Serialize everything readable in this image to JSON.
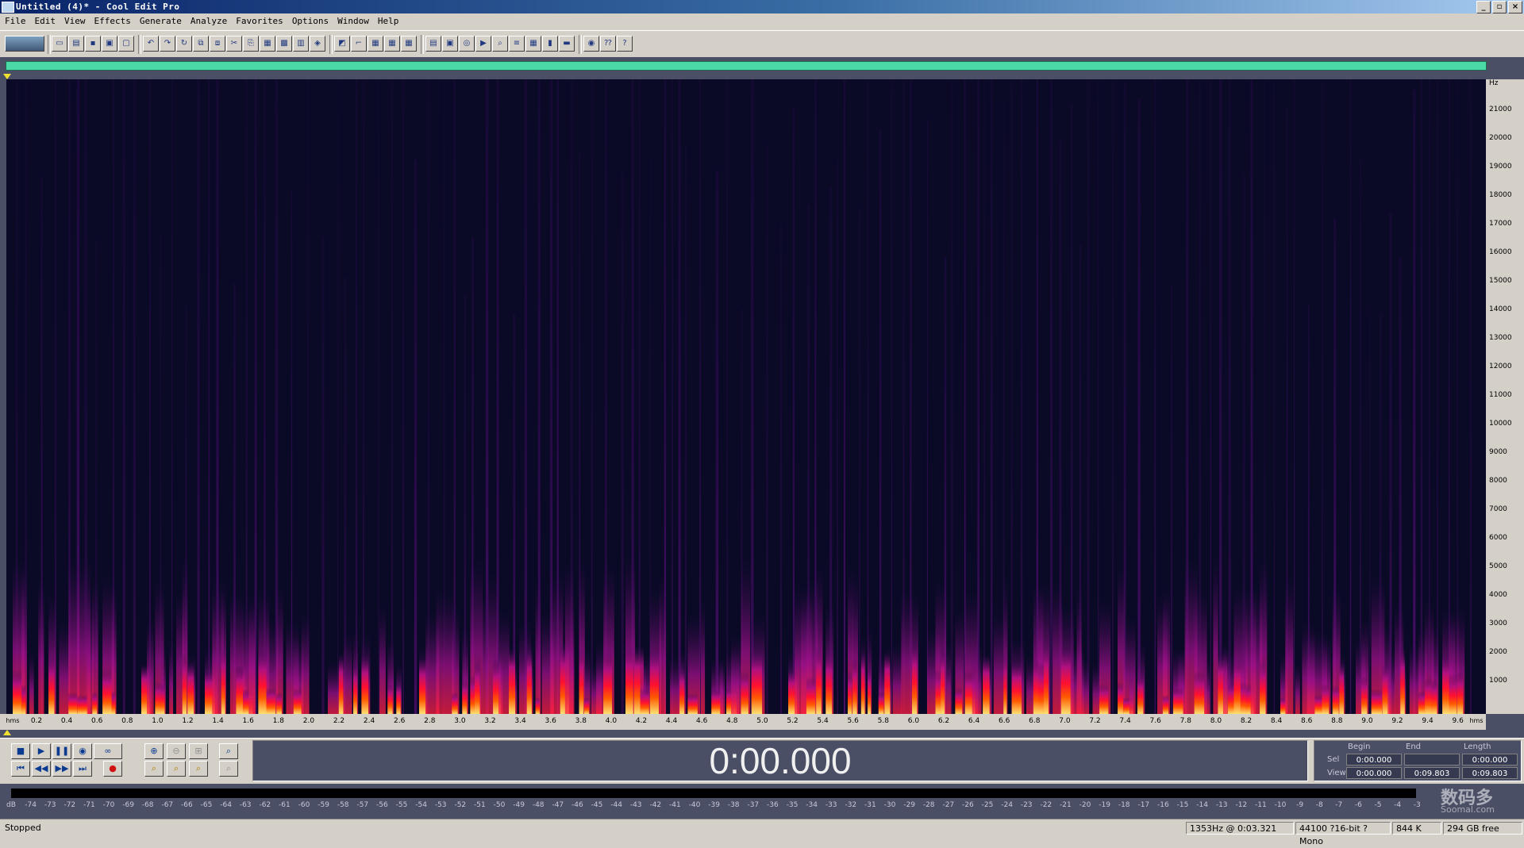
{
  "window": {
    "title": "Untitled (4)* - Cool Edit Pro",
    "buttons": [
      "_",
      "▫",
      "×"
    ]
  },
  "menu": [
    "File",
    "Edit",
    "View",
    "Effects",
    "Generate",
    "Analyze",
    "Favorites",
    "Options",
    "Window",
    "Help"
  ],
  "spectral": {
    "hz_unit": "Hz",
    "hz_ticks": [
      "21000",
      "20000",
      "19000",
      "18000",
      "17000",
      "16000",
      "15000",
      "14000",
      "13000",
      "12000",
      "11000",
      "10000",
      "9000",
      "8000",
      "7000",
      "6000",
      "5000",
      "4000",
      "3000",
      "2000",
      "1000"
    ],
    "time_unit_left": "hms",
    "time_unit_right": "hms",
    "time_ticks": [
      "0.2",
      "0.4",
      "0.6",
      "0.8",
      "1.0",
      "1.2",
      "1.4",
      "1.6",
      "1.8",
      "2.0",
      "2.2",
      "2.4",
      "2.6",
      "2.8",
      "3.0",
      "3.2",
      "3.4",
      "3.6",
      "3.8",
      "4.0",
      "4.2",
      "4.4",
      "4.6",
      "4.8",
      "5.0",
      "5.2",
      "5.4",
      "5.6",
      "5.8",
      "6.0",
      "6.2",
      "6.4",
      "6.6",
      "6.8",
      "7.0",
      "7.2",
      "7.4",
      "7.6",
      "7.8",
      "8.0",
      "8.2",
      "8.4",
      "8.6",
      "8.8",
      "9.0",
      "9.2",
      "9.4",
      "9.6"
    ]
  },
  "transport": {
    "time": "0:00.000",
    "headers": {
      "begin": "Begin",
      "end": "End",
      "length": "Length"
    },
    "sel": {
      "label": "Sel",
      "begin": "0:00.000",
      "end": "",
      "length": "0:00.000"
    },
    "view": {
      "label": "View",
      "begin": "0:00.000",
      "end": "0:09.803",
      "length": "0:09.803"
    }
  },
  "levels": [
    "dB",
    "-74",
    "-73",
    "-72",
    "-71",
    "-70",
    "-69",
    "-68",
    "-67",
    "-66",
    "-65",
    "-64",
    "-63",
    "-62",
    "-61",
    "-60",
    "-59",
    "-58",
    "-57",
    "-56",
    "-55",
    "-54",
    "-53",
    "-52",
    "-51",
    "-50",
    "-49",
    "-48",
    "-47",
    "-46",
    "-45",
    "-44",
    "-43",
    "-42",
    "-41",
    "-40",
    "-39",
    "-38",
    "-37",
    "-36",
    "-35",
    "-34",
    "-33",
    "-32",
    "-31",
    "-30",
    "-29",
    "-28",
    "-27",
    "-26",
    "-25",
    "-24",
    "-23",
    "-22",
    "-21",
    "-20",
    "-19",
    "-18",
    "-17",
    "-16",
    "-15",
    "-14",
    "-13",
    "-12",
    "-11",
    "-10",
    "-9",
    "-8",
    "-7",
    "-6",
    "-5",
    "-4",
    "-3"
  ],
  "watermark": {
    "line1": "数码多",
    "line2": "Soomal.com"
  },
  "status": {
    "state": "Stopped",
    "cursor": "1353Hz @   0:03.321",
    "format": "44100 ?16-bit ?Mono",
    "size": "844 K",
    "free": "294 GB free"
  }
}
